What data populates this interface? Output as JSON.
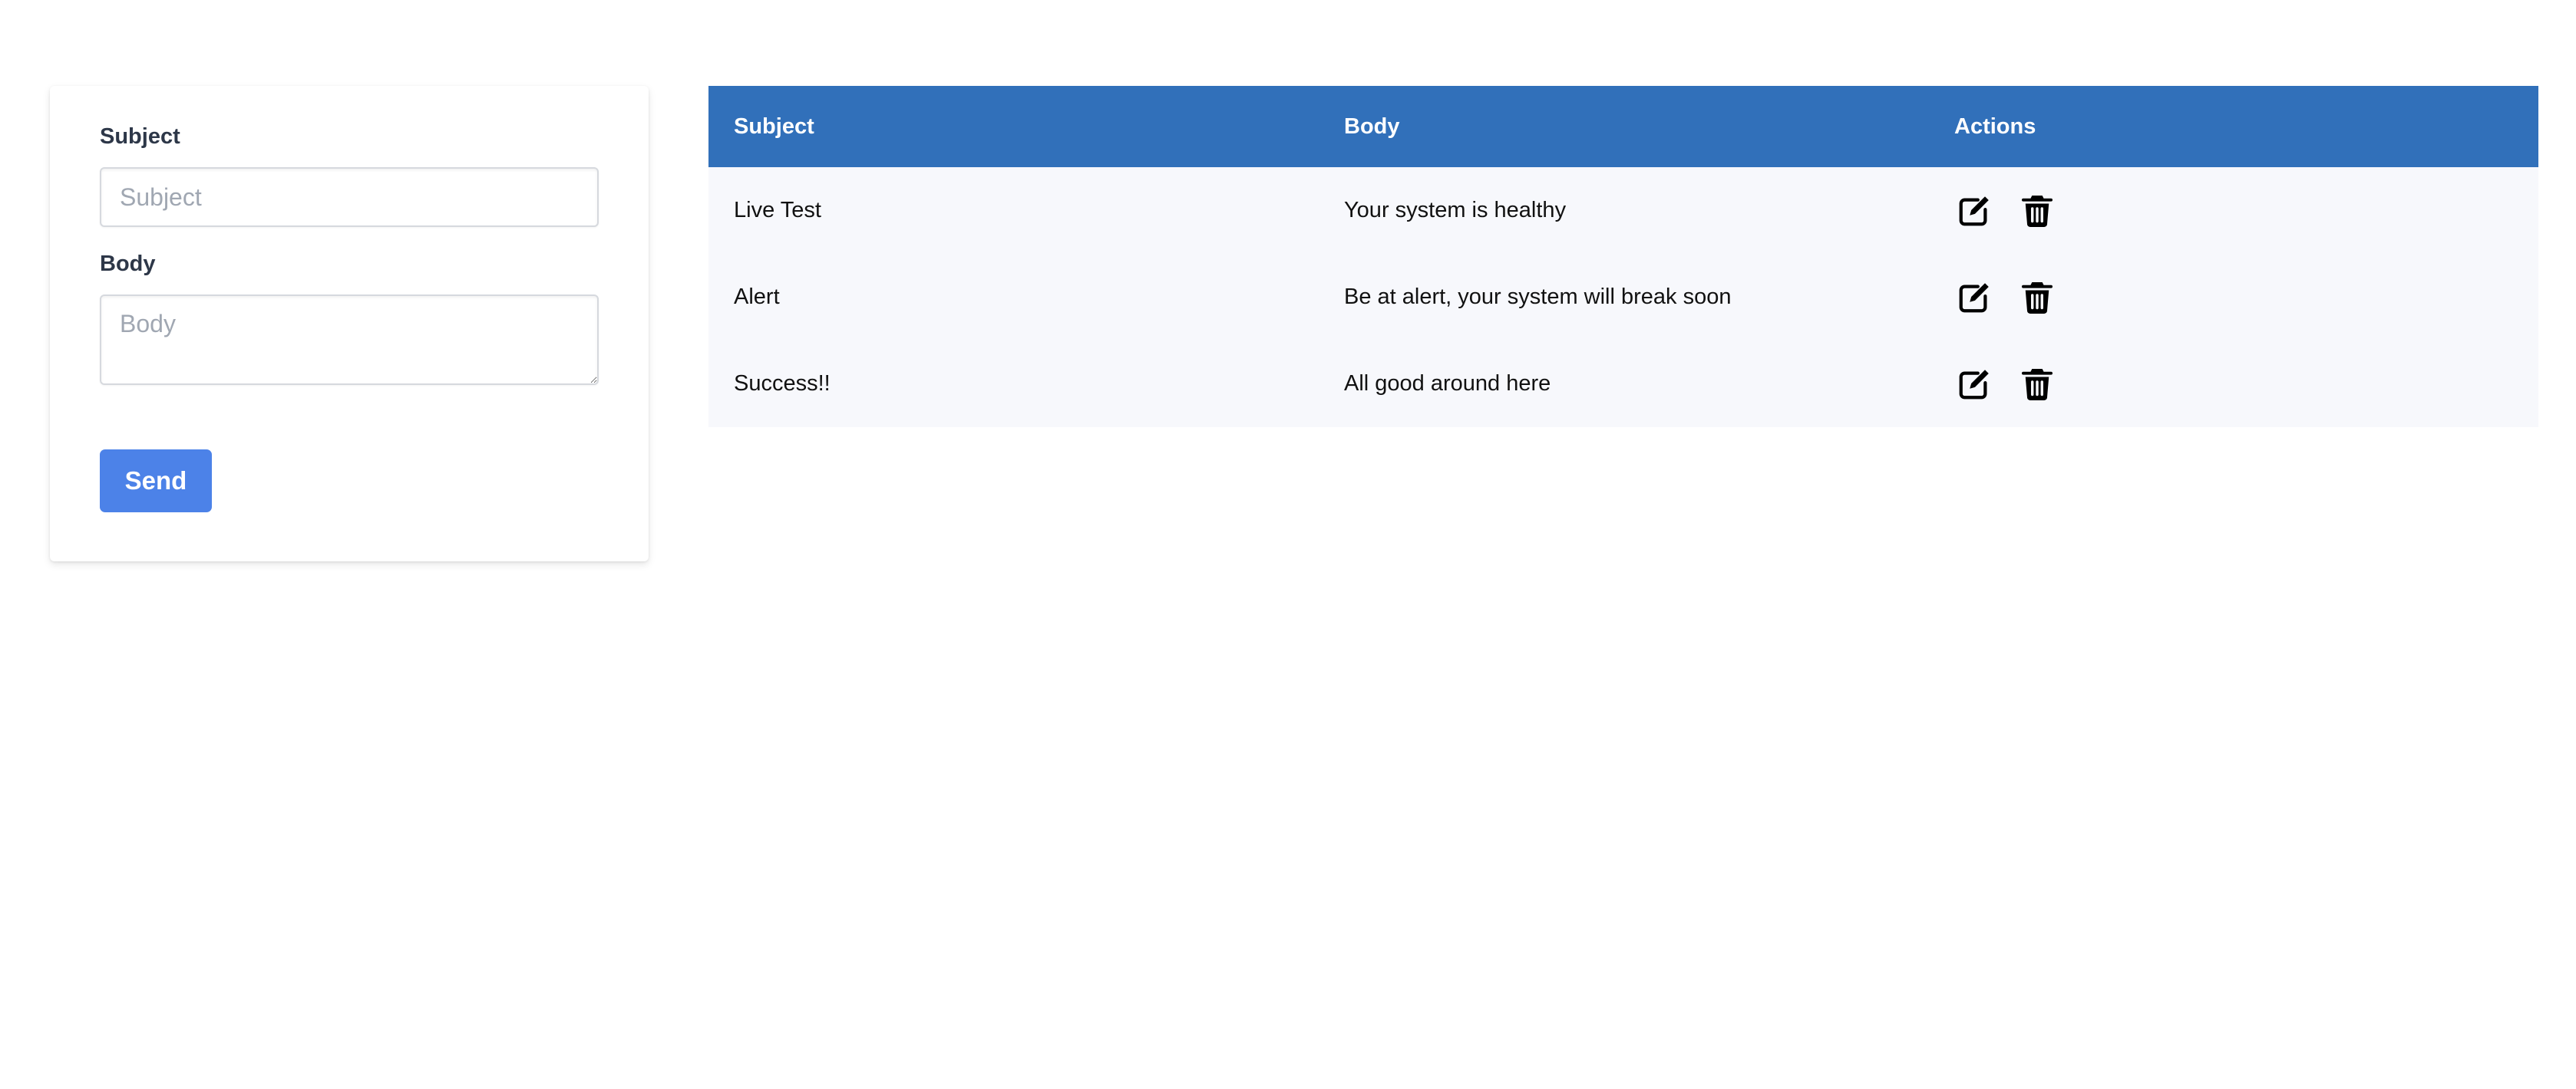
{
  "form": {
    "subject_label": "Subject",
    "subject_placeholder": "Subject",
    "subject_value": "",
    "body_label": "Body",
    "body_placeholder": "Body",
    "body_value": "",
    "send_label": "Send"
  },
  "table": {
    "headers": {
      "subject": "Subject",
      "body": "Body",
      "actions": "Actions"
    },
    "rows": [
      {
        "subject": "Live Test",
        "body": "Your system is healthy"
      },
      {
        "subject": "Alert",
        "body": "Be at alert, your system will break soon"
      },
      {
        "subject": "Success!!",
        "body": "All good around here"
      }
    ],
    "row_actions": [
      "edit-icon",
      "trash-icon"
    ]
  },
  "colors": {
    "header_bg": "#3170ba",
    "button_bg": "#4c82e8",
    "row_bg": "#f7f8fc"
  }
}
